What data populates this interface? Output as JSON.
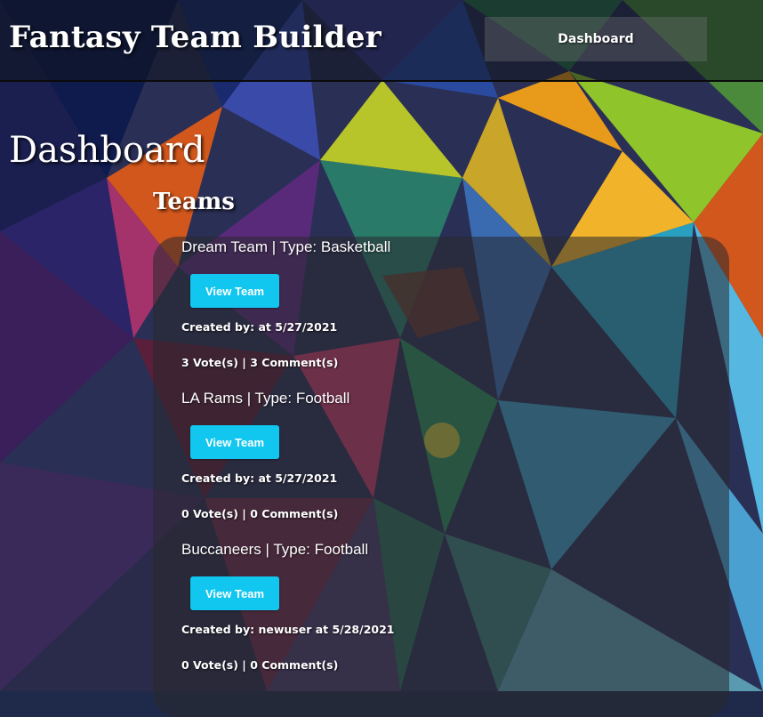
{
  "header": {
    "brand": "Fantasy Team Builder",
    "nav_dashboard": "Dashboard"
  },
  "main": {
    "title": "Dashboard",
    "section_title": "Teams",
    "view_label": "View Team",
    "teams": [
      {
        "name": "Dream Team | Type: Basketball",
        "created": "Created by: at 5/27/2021",
        "stats": "3 Vote(s) | 3 Comment(s)"
      },
      {
        "name": "LA Rams | Type: Football",
        "created": "Created by: at 5/27/2021",
        "stats": "0 Vote(s) | 0 Comment(s)"
      },
      {
        "name": "Buccaneers | Type: Football",
        "created": "Created by: newuser at 5/28/2021",
        "stats": "0 Vote(s) | 0 Comment(s)"
      }
    ]
  },
  "colors": {
    "button": "#11c6ef",
    "text": "#ffffff"
  }
}
